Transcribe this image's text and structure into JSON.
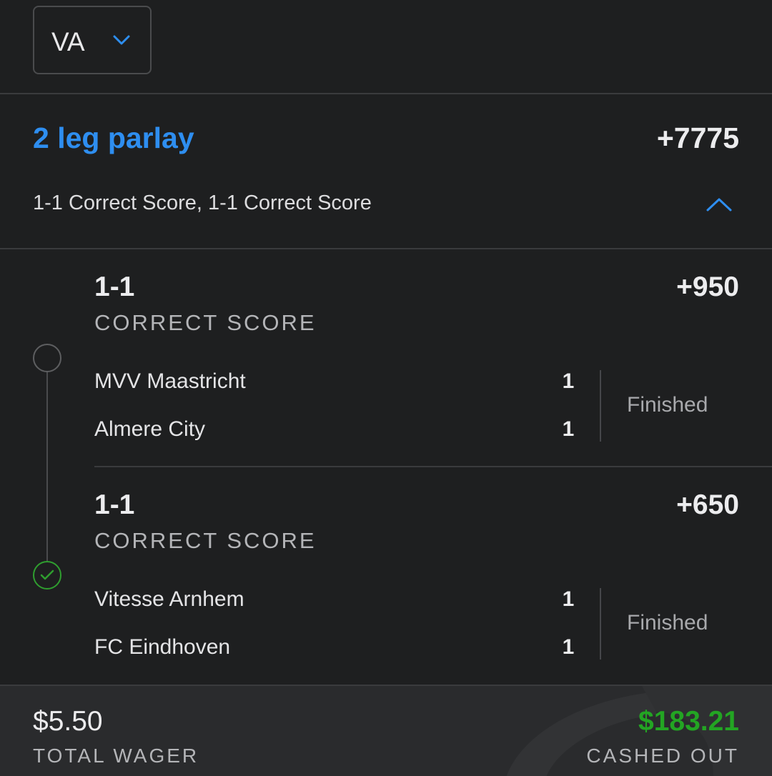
{
  "state_selector": {
    "value": "VA",
    "icon": "chevron-down-icon"
  },
  "parlay": {
    "title": "2 leg parlay",
    "odds": "+7775",
    "summary": "1-1 Correct Score, 1-1 Correct Score",
    "collapse_icon": "chevron-up-icon",
    "accent_color": "#2e8ef0"
  },
  "legs": [
    {
      "selection": "1-1",
      "market": "CORRECT SCORE",
      "odds": "+950",
      "result_icon": "empty-circle-icon",
      "teams": [
        {
          "name": "MVV Maastricht",
          "score": "1"
        },
        {
          "name": "Almere City",
          "score": "1"
        }
      ],
      "status": "Finished"
    },
    {
      "selection": "1-1",
      "market": "CORRECT SCORE",
      "odds": "+650",
      "result_icon": "check-circle-icon",
      "teams": [
        {
          "name": "Vitesse Arnhem",
          "score": "1"
        },
        {
          "name": "FC Eindhoven",
          "score": "1"
        }
      ],
      "status": "Finished"
    }
  ],
  "footer": {
    "wager_amount": "$5.50",
    "wager_label": "TOTAL WAGER",
    "payout_amount": "$183.21",
    "payout_label": "CASHED OUT",
    "payout_color": "#23a523"
  }
}
